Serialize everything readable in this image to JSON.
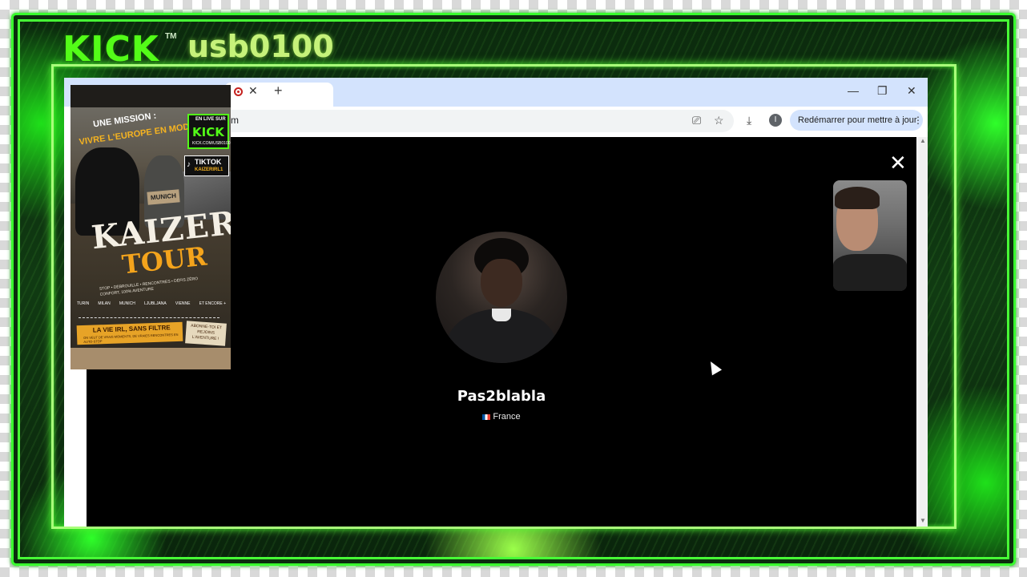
{
  "overlay": {
    "logo": "KICK",
    "logo_tm": "TM",
    "channel": "usb0100"
  },
  "browser": {
    "tab_close": "✕",
    "new_tab": "+",
    "window_controls": {
      "minimize": "—",
      "maximize": "❐",
      "close": "✕"
    },
    "url_fragment": "m",
    "profile_initial": "I",
    "update_button": "Redémarrer pour mettre à jour",
    "update_more": "⋮"
  },
  "call": {
    "close": "✕",
    "username": "Pas2blabla",
    "country": "France"
  },
  "poster": {
    "mission_line1": "UNE MISSION :",
    "mission_line2": "VIVRE L'EUROPE EN MODE IRL",
    "kick_live": "EN LIVE SUR",
    "kick_text": "KICK",
    "kick_url": "KICK.COM/USB0100",
    "tiktok_label": "TIKTOK",
    "tiktok_handle": "KAIZERIRL1",
    "munich_sign": "MUNICH",
    "title_1": "KAIZER",
    "title_2": "TOUR",
    "tagline": "STOP • DÉBROUILLE • RENCONTRES • DÉFIS ZÉRO CONFORT, 100% AVENTURE",
    "cities": [
      "TURIN",
      "MILAN",
      "MUNICH",
      "LJUBLJANA",
      "VIENNE",
      "ET ENCORE +"
    ],
    "slogan": "LA VIE IRL, SANS FILTRE",
    "slogan_sub": "ON VEUT DE VRAIS MOMENTS, DE VRAIES RENCONTRES EN AUTO-STOP",
    "subscribe": "ABONNE-TOI ET REJOINS L'AVENTURE !"
  },
  "colors": {
    "kick_green": "#53fc18",
    "frame_green": "#39ff2e",
    "call_bg": "#000000",
    "chrome_tab": "#d3e3fd"
  },
  "icons": [
    "record-icon",
    "cast-icon",
    "star-icon",
    "download-icon",
    "more-vert-icon",
    "close-icon",
    "cursor-icon"
  ]
}
